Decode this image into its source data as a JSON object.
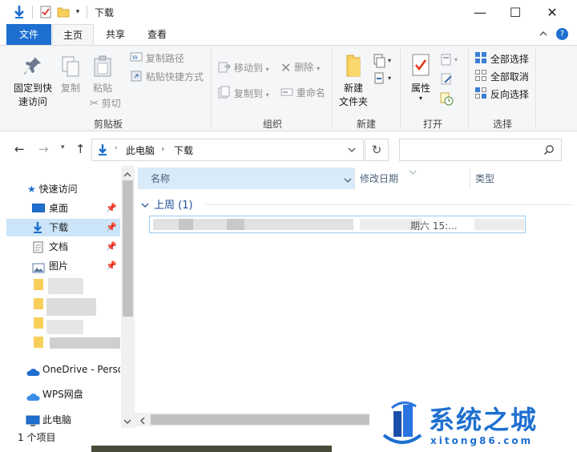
{
  "titlebar": {
    "title": "下载",
    "minimize": "—",
    "maximize": "☐",
    "close": "✕"
  },
  "tabs": {
    "file": "文件",
    "home": "主页",
    "share": "共享",
    "view": "查看",
    "collapse_icon": "chevron-up",
    "help_icon": "?"
  },
  "ribbon": {
    "clipboard": {
      "pin": "固定到快\n速访问",
      "copy": "复制",
      "paste": "粘贴",
      "cut": "剪切",
      "copy_path": "复制路径",
      "paste_shortcut": "粘贴快捷方式",
      "label": "剪贴板"
    },
    "organize": {
      "move_to": "移动到",
      "copy_to": "复制到",
      "delete": "删除",
      "rename": "重命名",
      "label": "组织"
    },
    "new": {
      "new_folder": "新建\n文件夹",
      "label": "新建"
    },
    "open": {
      "properties": "属性",
      "label": "打开"
    },
    "select": {
      "select_all": "全部选择",
      "select_none": "全部取消",
      "invert": "反向选择",
      "label": "选择"
    }
  },
  "address": {
    "path": [
      "此电脑",
      "下载"
    ],
    "refresh": "↻",
    "search_placeholder": ""
  },
  "nav": {
    "quick_access": "快速访问",
    "items": [
      {
        "label": "桌面",
        "pinned": true
      },
      {
        "label": "下载",
        "pinned": true
      },
      {
        "label": "文档",
        "pinned": true
      },
      {
        "label": "图片",
        "pinned": true
      }
    ],
    "onedrive": "OneDrive - Perso",
    "wps": "WPS网盘",
    "this_pc": "此电脑"
  },
  "content": {
    "columns": [
      "名称",
      "修改日期",
      "类型"
    ],
    "group": "上周 (1)",
    "file_date": "期六 15:..."
  },
  "status": {
    "count": "1 个项目"
  },
  "watermark": {
    "text": "系统之城",
    "url": "xitong86.com"
  }
}
